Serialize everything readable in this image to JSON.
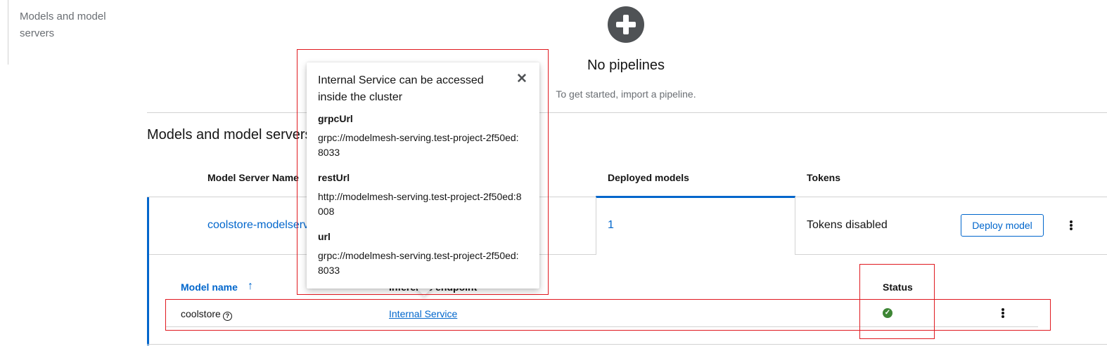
{
  "jump_nav": {
    "item": "Models and model servers"
  },
  "pipelines_empty": {
    "icon": "plus-circle-icon",
    "title": "No pipelines",
    "body": "To get started, import a pipeline."
  },
  "models_section": {
    "title": "Models and model servers",
    "columns": [
      "Model Server Name",
      "Deployed models",
      "Tokens"
    ],
    "row": {
      "server_name": "coolstore-modelserver",
      "deployed_models": "1",
      "tokens": "Tokens disabled",
      "deploy_button": "Deploy model",
      "kebab_icon": "kebab-icon"
    },
    "nested_table": {
      "columns": [
        "Model name",
        "Inference endpoint",
        "Status"
      ],
      "sort_icon": "arrow-up-icon",
      "row": {
        "model_name": "coolstore",
        "help_icon": "question-circle-icon",
        "endpoint_link": "Internal Service",
        "status_icon": "check-circle-icon",
        "status_color": "#3e8635"
      }
    }
  },
  "popover": {
    "title": "Internal Service can be accessed inside the cluster",
    "close_icon": "close-icon",
    "fields": [
      {
        "label": "grpcUrl",
        "value": "grpc://modelmesh-serving.test-project-2f50ed:8033"
      },
      {
        "label": "restUrl",
        "value": "http://modelmesh-serving.test-project-2f50ed:8008"
      },
      {
        "label": "url",
        "value": "grpc://modelmesh-serving.test-project-2f50ed:8033"
      }
    ]
  },
  "colors": {
    "link": "#0066cc",
    "annotation": "#e0191f"
  }
}
